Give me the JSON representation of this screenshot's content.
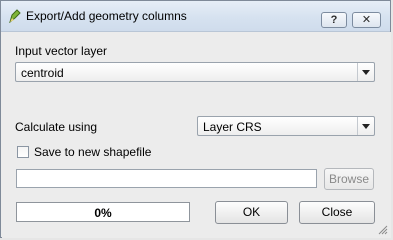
{
  "window": {
    "title": "Export/Add geometry columns",
    "help_label": "?",
    "close_label": "✕"
  },
  "input_layer": {
    "label": "Input vector layer",
    "selected": "centroid"
  },
  "calculate": {
    "label": "Calculate using",
    "selected": "Layer CRS"
  },
  "save_shapefile": {
    "label": "Save to new shapefile",
    "checked": false,
    "path_value": "",
    "browse_label": "Browse"
  },
  "progress": {
    "value_text": "0%",
    "fraction": 0
  },
  "buttons": {
    "ok_label": "OK",
    "close_label": "Close"
  },
  "colors": {
    "titlebar": "#d6e2f0",
    "progress_fill": "#3a8ee6",
    "app_icon": "#7fb539"
  },
  "icons": {
    "app": "qgis-pencil-icon",
    "dropdown": "chevron-down-icon",
    "resize": "resize-grip-icon"
  }
}
